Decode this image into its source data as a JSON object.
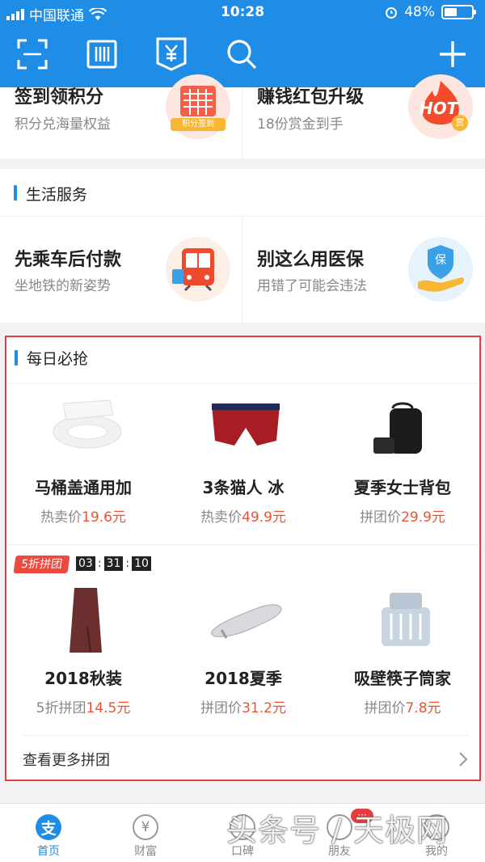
{
  "status_bar": {
    "carrier": "中国联通",
    "time": "10:28",
    "battery": "48%",
    "battery_level": 0.48
  },
  "toolbar": {
    "scan": "scan-icon",
    "paycode": "barcode-icon",
    "collect": "yuan-icon",
    "search": "search-icon",
    "add": "plus-icon"
  },
  "top_tiles": [
    {
      "title": "签到领积分",
      "subtitle": "积分兑海量权益",
      "badge": "积分签到"
    },
    {
      "title": "赚钱红包升级",
      "subtitle": "18份赏金到手",
      "badge": "HOT",
      "badge2": "赏"
    }
  ],
  "life_services": {
    "heading": "生活服务",
    "tiles": [
      {
        "title": "先乘车后付款",
        "subtitle": "坐地铁的新姿势"
      },
      {
        "title": "别这么用医保",
        "subtitle": "用错了可能会违法",
        "badge": "保"
      }
    ]
  },
  "daily_deals": {
    "heading": "每日必抢",
    "row1": [
      {
        "name": "马桶盖通用加",
        "price_label": "热卖价",
        "price": "19.6元"
      },
      {
        "name": "3条猫人 冰",
        "price_label": "热卖价",
        "price": "49.9元"
      },
      {
        "name": "夏季女士背包",
        "price_label": "拼团价",
        "price": "29.9元"
      }
    ],
    "group_badge": "5折拼团",
    "countdown": [
      "03",
      "31",
      "10"
    ],
    "row2": [
      {
        "name": "2018秋装",
        "price_label": "5折拼团",
        "price": "14.5元"
      },
      {
        "name": "2018夏季",
        "price_label": "拼团价",
        "price": "31.2元"
      },
      {
        "name": "吸壁筷子筒家",
        "price_label": "拼团价",
        "price": "7.8元"
      }
    ],
    "more": "查看更多拼团"
  },
  "tabbar": [
    {
      "label": "首页",
      "icon": "alipay-icon",
      "active": true
    },
    {
      "label": "财富",
      "icon": "yuan-circle-icon"
    },
    {
      "label": "口碑",
      "icon": "koubei-icon"
    },
    {
      "label": "朋友",
      "icon": "friends-icon",
      "badge": "···"
    },
    {
      "label": "我的",
      "icon": "me-icon"
    }
  ],
  "watermark": "头条号 / 天极网",
  "colors": {
    "brand_blue": "#1f8de6",
    "price_red": "#f0522f",
    "highlight_red": "#e53e3e"
  }
}
